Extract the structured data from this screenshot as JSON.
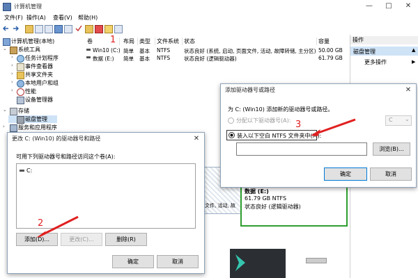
{
  "window": {
    "title": "计算机管理",
    "controls": [
      "—",
      "□",
      "✕"
    ]
  },
  "menu": [
    "文件(F)",
    "操作(A)",
    "查看(V)",
    "帮助(H)"
  ],
  "tree": {
    "root": "计算机管理(本地)",
    "items": [
      {
        "label": "系统工具",
        "level": 1,
        "icon": "tools-icon"
      },
      {
        "label": "任务计划程序",
        "level": 2,
        "icon": "clock-icon"
      },
      {
        "label": "事件查看器",
        "level": 2,
        "icon": "event-log-icon"
      },
      {
        "label": "共享文件夹",
        "level": 2,
        "icon": "shared-folder-icon"
      },
      {
        "label": "本地用户和组",
        "level": 2,
        "icon": "users-icon"
      },
      {
        "label": "性能",
        "level": 2,
        "icon": "performance-icon"
      },
      {
        "label": "设备管理器",
        "level": 2,
        "icon": "device-manager-icon"
      },
      {
        "label": "存储",
        "level": 1,
        "icon": "storage-icon"
      },
      {
        "label": "磁盘管理",
        "level": 2,
        "icon": "disk-icon"
      },
      {
        "label": "服务和应用程序",
        "level": 1,
        "icon": "services-icon"
      }
    ]
  },
  "volumes": {
    "headers": [
      "卷",
      "布局",
      "类型",
      "文件系统",
      "状态",
      "容量"
    ],
    "rows": [
      [
        "Win10 (C:)",
        "简单",
        "基本",
        "NTFS",
        "状态良好 (系统, 启动, 页面文件, 活动, 故障转储, 主分区)",
        "50.00 GB"
      ],
      [
        "数据 (E:)",
        "简单",
        "基本",
        "NTFS",
        "状态良好 (逻辑驱动器)",
        "61.79 GB"
      ]
    ]
  },
  "actions": {
    "header": "操作",
    "selected": "磁盘管理",
    "more": "更多操作"
  },
  "diskmap": {
    "left_fragment": "文件, 活动, 故",
    "partition": {
      "name": "数据 (E:)",
      "size": "61.79 GB NTFS",
      "status": "状态良好 (逻辑驱动器)"
    }
  },
  "change_dialog": {
    "title": "更改 C: (Win10) 的驱动器号和路径",
    "caption": "可用下列驱动器号和路径访问这个卷(A):",
    "list_item": "C:",
    "buttons": {
      "add": "添加(D)...",
      "change": "更改(C)...",
      "delete": "删除(R)",
      "ok": "确定",
      "cancel": "取消"
    }
  },
  "add_dialog": {
    "title": "添加驱动器号或路径",
    "caption": "为 C: (Win10) 添加新的驱动器号或路径。",
    "option1": "分配以下驱动器号(A):",
    "option1_value": "C",
    "option2": "装入以下空白 NTFS 文件夹中(M):",
    "path_value": "",
    "browse": "浏览(B)...",
    "ok": "确定",
    "cancel": "取消"
  },
  "annotations": [
    "1",
    "2",
    "3"
  ],
  "colors": {
    "accent": "#0078d7",
    "annotation": "#e02020",
    "selection": "#cfe3f7",
    "partition_border": "#2e9e2e"
  }
}
